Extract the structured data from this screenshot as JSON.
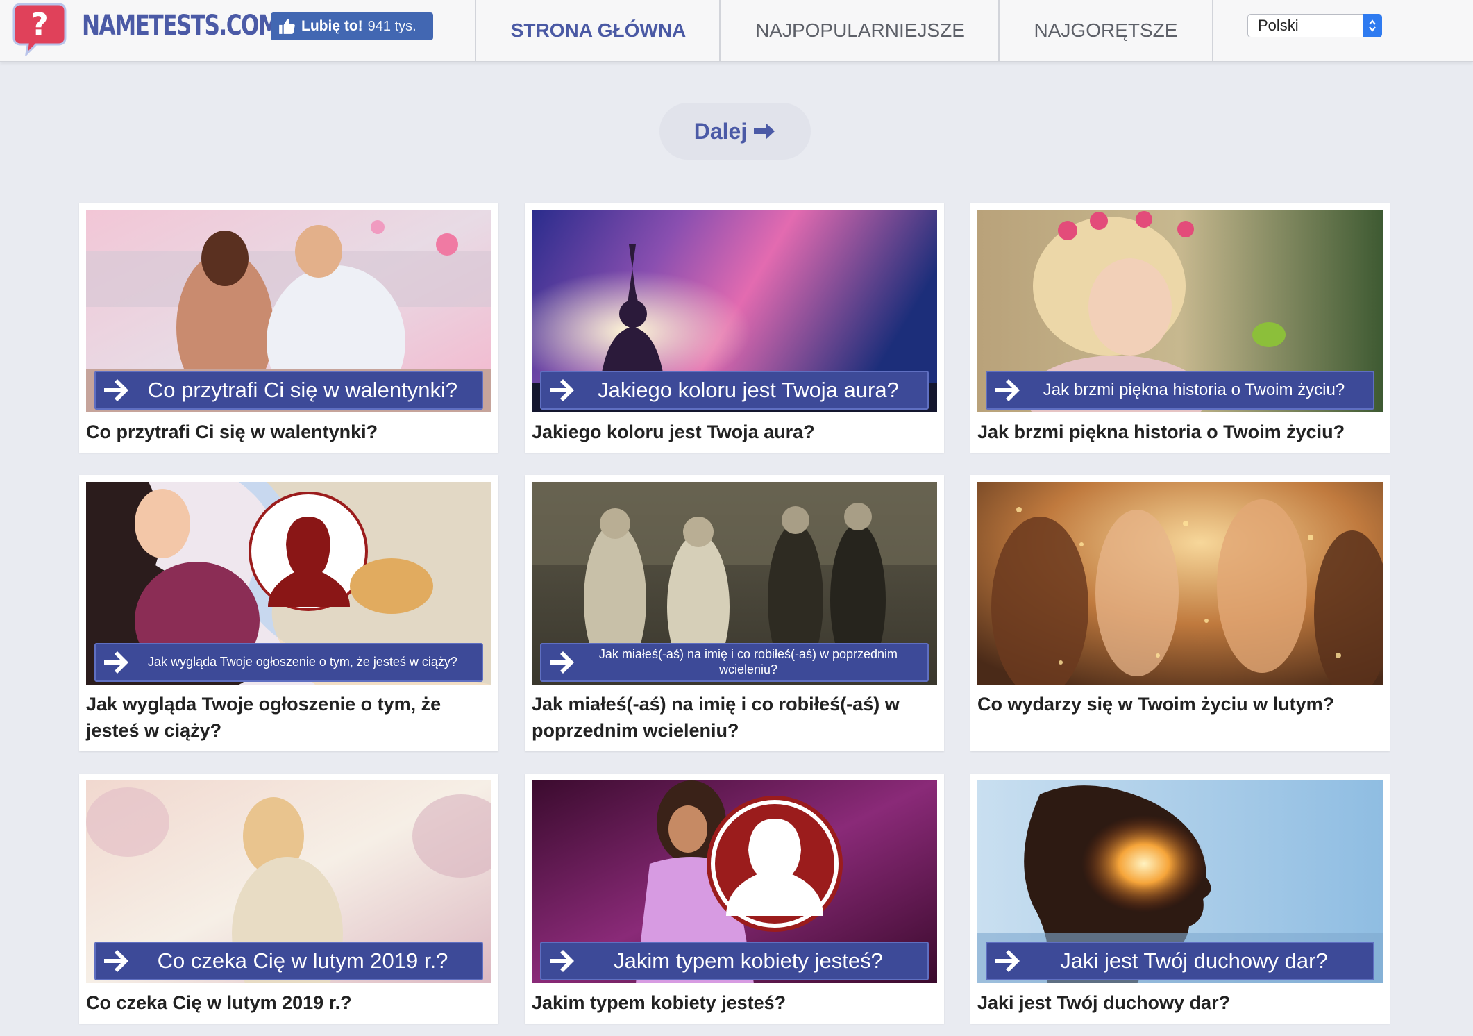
{
  "header": {
    "logo_text": "NAMETESTS.COM",
    "like_label": "Lubię to!",
    "like_count": "941 tys.",
    "nav": {
      "home": "STRONA GŁÓWNA",
      "popular": "NAJPOPULARNIEJSZE",
      "hot": "NAJGORĘTSZE"
    },
    "language": "Polski"
  },
  "next_label": "Dalej",
  "colors": {
    "brand": "#4b5aa6",
    "facebook": "#4267b2",
    "banner": "#3d4a98",
    "page_bg": "#e9ebf1"
  },
  "cards": [
    {
      "banner": "Co przytrafi Ci się w walentynki?",
      "title": "Co przytrafi Ci się w walentynki?"
    },
    {
      "banner": "Jakiego koloru jest Twoja aura?",
      "title": "Jakiego koloru jest Twoja aura?"
    },
    {
      "banner": "Jak brzmi piękna historia o Twoim życiu?",
      "title": "Jak brzmi piękna historia o Twoim życiu?"
    },
    {
      "banner": "Jak wygląda Twoje ogłoszenie o tym, że jesteś w ciąży?",
      "title": "Jak wygląda Twoje ogłoszenie o tym, że jesteś w ciąży?"
    },
    {
      "banner": "Jak miałeś(-aś) na imię i co robiłeś(-aś) w poprzednim wcieleniu?",
      "title": "Jak miałeś(-aś) na imię i co robiłeś(-aś) w poprzednim wcieleniu?"
    },
    {
      "banner": "",
      "title": "Co wydarzy się w Twoim życiu w lutym?"
    },
    {
      "banner": "Co czeka Cię w lutym 2019 r.?",
      "title": "Co czeka Cię w lutym 2019 r.?"
    },
    {
      "banner": "Jakim typem kobiety jesteś?",
      "title": "Jakim typem kobiety jesteś?"
    },
    {
      "banner": "Jaki jest Twój duchowy dar?",
      "title": "Jaki jest Twój duchowy dar?"
    }
  ]
}
